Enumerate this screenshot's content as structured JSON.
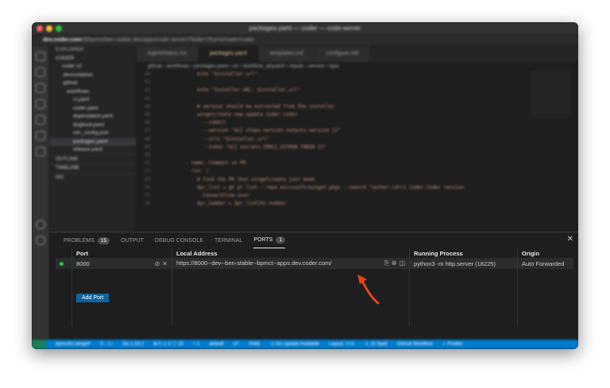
{
  "window": {
    "title": "packages.yaml — coder — code-server",
    "url_host": "dev.coder.com",
    "url_path": "/@bpmct/ben-stable.dev/apps/code-server/?folder=/home/coder/coder"
  },
  "sidebar": {
    "header": "EXPLORER",
    "items": [
      "CODER",
      "coder v2",
      ".devcontainer",
      ".github",
      "workflows",
      "ci.yaml",
      "coder.yaml",
      "dependabot.yaml",
      "dogfood.yaml",
      "mlc_config.json",
      "packages.yaml",
      "release.yaml"
    ],
    "sections": [
      "OUTLINE",
      "TIMELINE",
      "GO"
    ]
  },
  "editor": {
    "tabs": [
      "AgentStatus.tsx",
      "packages.yaml",
      "templates.md",
      "configure.md"
    ],
    "breadcrumb": "github › workflows › packages.yaml › on › workflow_dispatch › inputs › version › type",
    "lines": [
      [
        "40",
        "          echo \"$installer_url\""
      ],
      [
        "41",
        ""
      ],
      [
        "42",
        "          echo \"Installer URL: $installer_url\""
      ],
      [
        "43",
        ""
      ],
      [
        "44",
        "          # version should be extracted from the installer"
      ],
      [
        "45",
        "          wingetcreate new update Coder.Coder"
      ],
      [
        "46",
        "            --submit"
      ],
      [
        "47",
        "            --version \"${{ steps.version.outputs.version }}\""
      ],
      [
        "48",
        "            --urls \"$installer_url\""
      ],
      [
        "49",
        "            --token \"${{ secrets.CDRCI_GITHUB_TOKEN }}\""
      ],
      [
        "50",
        ""
      ],
      [
        "51",
        "      - name: Comment on PR"
      ],
      [
        "52",
        "        run: |"
      ],
      [
        "53",
        "          # find the PR that wingetcreate just made"
      ],
      [
        "54",
        "          $pr_list = gh pr list --repo microsoft/winget-pkgs --search \"author:cdrci Coder.Coder version"
      ],
      [
        "55",
        "            ConvertFrom-Json"
      ],
      [
        "56",
        "          $pr_number = $pr_list[0].number"
      ]
    ]
  },
  "panel": {
    "tabs": [
      {
        "label": "PROBLEMS",
        "badge": "15"
      },
      {
        "label": "OUTPUT"
      },
      {
        "label": "DEBUG CONSOLE"
      },
      {
        "label": "TERMINAL"
      },
      {
        "label": "PORTS",
        "badge": "1"
      }
    ],
    "columns": [
      "Port",
      "Local Address",
      "Running Process",
      "Origin"
    ],
    "rows": [
      {
        "port": "8000",
        "address": "https://8000--dev--ben-stable--bpmct--apps.dev.coder.com/",
        "process": "python3 -m http.server (18225)",
        "origin": "Auto Forwarded"
      }
    ],
    "add_port": "Add Port"
  },
  "status": [
    "bpmct/tz-winget*",
    "0 ↓ 1↑",
    "Go 1.19.2",
    "⊗ 0 ⚠ 0 ⓘ 15",
    "⑂ 1",
    "default",
    "LF",
    "YAML",
    "⚠ Go Update Available",
    "Layout: U.S.",
    "⚠ 10 Spell",
    "GitHub Workflow",
    "✓ Prettier"
  ],
  "colors": {
    "accent": "#007acc",
    "arrow": "#e8431f"
  }
}
